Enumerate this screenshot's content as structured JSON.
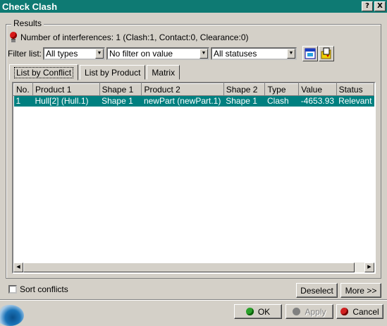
{
  "window": {
    "title": "Check Clash",
    "help_btn": "?",
    "close_btn": "X"
  },
  "results": {
    "group_label": "Results",
    "interferences": "Number of interferences: 1 (Clash:1, Contact:0, Clearance:0)"
  },
  "filter": {
    "label": "Filter list:",
    "type_value": "All types",
    "value_filter": "No filter on value",
    "status_value": "All statuses"
  },
  "tabs": [
    "List by Conflict",
    "List by Product",
    "Matrix"
  ],
  "table": {
    "columns": [
      "No.",
      "Product 1",
      "Shape 1",
      "Product 2",
      "Shape 2",
      "Type",
      "Value",
      "Status"
    ],
    "rows": [
      [
        "1",
        "Hull[2] (Hull.1)",
        "Shape 1",
        "newPart (newPart.1)",
        "Shape 1",
        "Clash",
        "-4653.93",
        "Relevant"
      ]
    ]
  },
  "sort_label": "Sort conflicts",
  "buttons": {
    "deselect": "Deselect",
    "more": "More >>",
    "ok": "OK",
    "apply": "Apply",
    "cancel": "Cancel"
  },
  "colors": {
    "title_bg": "#0e7a73",
    "selection": "#008080",
    "ok_dot": "#2aa02a",
    "cancel_dot": "#d02020"
  }
}
